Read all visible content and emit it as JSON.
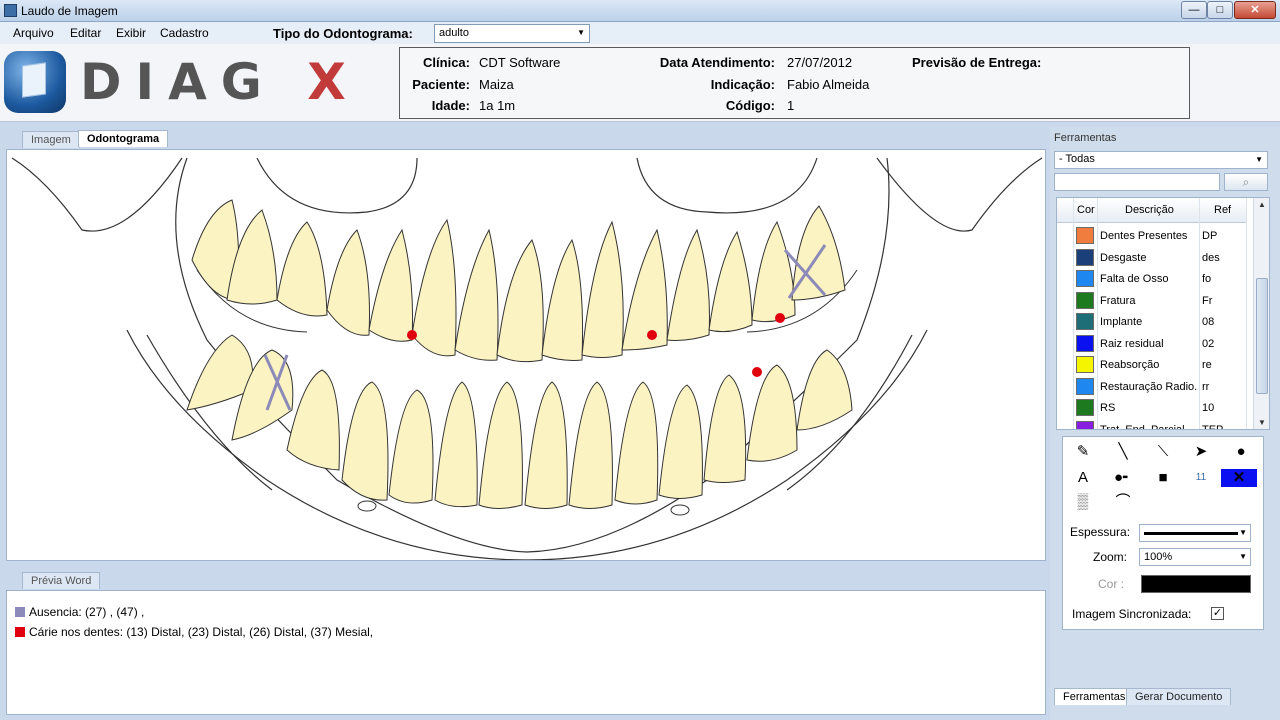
{
  "window": {
    "title": "Laudo de Imagem",
    "minimize": "—",
    "maximize": "□",
    "close": "✕"
  },
  "menu": [
    "Arquivo",
    "Editar",
    "Exibir",
    "Cadastro"
  ],
  "odontograma_type": {
    "label": "Tipo do Odontograma:",
    "value": "adulto"
  },
  "logo": {
    "text": "DIAG",
    "x_text": "X"
  },
  "info": {
    "clinica_label": "Clínica:",
    "clinica": "CDT Software",
    "paciente_label": "Paciente:",
    "paciente": "Maiza",
    "idade_label": "Idade:",
    "idade": "1a 1m",
    "data_label": "Data Atendimento:",
    "data": "27/07/2012",
    "indicacao_label": "Indicação:",
    "indicacao": "Fabio Almeida",
    "codigo_label": "Código:",
    "codigo": "1",
    "previsao_label": "Previsão de Entrega:"
  },
  "tabs": {
    "imagem": "Imagem",
    "odontograma": "Odontograma",
    "previa": "Prévia Word"
  },
  "word_preview": [
    {
      "color": "#8c8ab8",
      "text": "Ausencia: (27) , (47) ,"
    },
    {
      "color": "#e0000e",
      "text": "Cárie nos dentes: (13) Distal, (23) Distal, (26) Distal, (37) Mesial,"
    }
  ],
  "tools": {
    "title": "Ferramentas",
    "filter": "- Todas",
    "search_placeholder": "",
    "search_icon": "magnifier-icon",
    "columns": {
      "cor": "Cor",
      "descricao": "Descrição",
      "ref": "Ref"
    },
    "rows": [
      {
        "color": "#f07c3e",
        "desc": "Dentes Presentes",
        "ref": "DP"
      },
      {
        "color": "#1b3f78",
        "desc": "Desgaste",
        "ref": "des"
      },
      {
        "color": "#1e88f0",
        "desc": "Falta de Osso",
        "ref": "fo"
      },
      {
        "color": "#1e7a1e",
        "desc": "Fratura",
        "ref": "Fr"
      },
      {
        "color": "#1e6e78",
        "desc": "Implante",
        "ref": "08"
      },
      {
        "color": "#0a10f0",
        "desc": "Raiz residual",
        "ref": "02"
      },
      {
        "color": "#f5f500",
        "desc": "Reabsorção",
        "ref": "re"
      },
      {
        "color": "#1e88f0",
        "desc": "Restauração Radio...",
        "ref": "rr"
      },
      {
        "color": "#1e7a1e",
        "desc": "RS",
        "ref": "10"
      },
      {
        "color": "#8a1ee0",
        "desc": "Trat. End. Parcial",
        "ref": "TEP"
      }
    ],
    "text_tool": "A",
    "number_tool": "11",
    "espessura_label": "Espessura:",
    "zoom_label": "Zoom:",
    "zoom_value": "100%",
    "cor_label": "Cor :",
    "sync_label": "Imagem Sincronizada:",
    "sync_checked": "✓"
  },
  "bottom_tabs": {
    "ferramentas": "Ferramentas",
    "gerar": "Gerar Documento"
  }
}
